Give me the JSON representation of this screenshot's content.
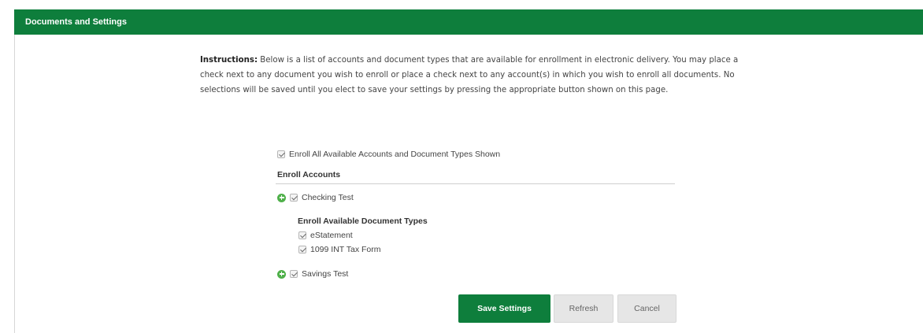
{
  "header": {
    "title": "Documents and Settings"
  },
  "instructions": {
    "label": "Instructions:",
    "text": "Below is a list of accounts and document types that are available for enrollment in electronic delivery. You may place a check next to any document you wish to enroll or place a check next to any account(s) in which you wish to enroll all documents. No selections will be saved until you elect to save your settings by pressing the appropriate button shown on this page."
  },
  "enroll_all": {
    "label": "Enroll All Available Accounts and Document Types Shown",
    "checked": true
  },
  "accounts": {
    "heading": "Enroll Accounts",
    "items": [
      {
        "name": "Checking Test",
        "checked": true,
        "expanded": true
      },
      {
        "name": "Savings Test",
        "checked": true,
        "expanded": false
      }
    ]
  },
  "document_types": {
    "heading": "Enroll Available Document Types",
    "items": [
      {
        "label": "eStatement",
        "checked": true
      },
      {
        "label": "1099 INT Tax Form",
        "checked": true
      }
    ]
  },
  "buttons": {
    "save": "Save Settings",
    "refresh": "Refresh",
    "cancel": "Cancel"
  },
  "colors": {
    "brand_green": "#0e7e3c",
    "expand_icon": "#4fb04a"
  },
  "icons": {
    "expand": "plus-circle-icon",
    "checkbox": "checkmark-icon"
  }
}
